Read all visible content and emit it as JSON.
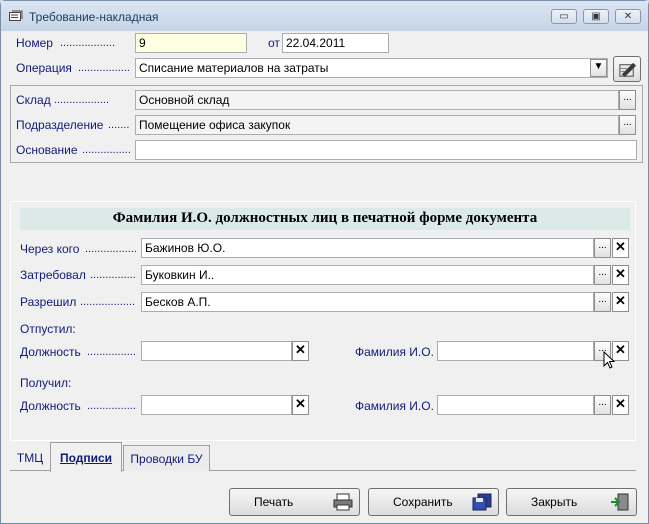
{
  "window": {
    "title": "Требование-накладная",
    "min_btn": "▭",
    "max_btn": "▣",
    "close_btn": "✕"
  },
  "form": {
    "nomer_label": "Номер",
    "nomer_value": "9",
    "ot_label": "от",
    "date_value": "22.04.2011",
    "operation_label": "Операция",
    "operation_value": "Списание материалов на затраты",
    "sklad_label": "Склад",
    "sklad_value": "Основной склад",
    "podr_label": "Подразделение",
    "podr_value": "Помещение офиса закупок",
    "osnovanie_label": "Основание",
    "osnovanie_value": ""
  },
  "signatures": {
    "header": "Фамилия И.О. должностных лиц в печатной форме документа",
    "cherez_label": "Через кого",
    "cherez_value": "Бажинов Ю.О.",
    "zatreboval_label": "Затребовал",
    "zatreboval_value": "Буковкин И..",
    "razreshil_label": "Разрешил",
    "razreshil_value": "Бесков А.П.",
    "otpustil_label": "Отпустил:",
    "poluchil_label": "Получил:",
    "dolzhnost_label": "Должность",
    "fio_label": "Фамилия И.О.",
    "otpustil_dolzhnost": "",
    "otpustil_fio": "",
    "poluchil_dolzhnost": "",
    "poluchil_fio": ""
  },
  "tabs": [
    "ТМЦ",
    "Подписи",
    "Проводки БУ"
  ],
  "active_tab": "Подписи",
  "buttons": {
    "print": "Печать",
    "save": "Сохранить",
    "close": "Закрыть"
  },
  "ellipsis": "...",
  "clear": "✕",
  "dropdown": "▼",
  "dots_short": "..................",
  "dots_long": "...................................",
  "colors": {
    "label": "#101a7a",
    "header_bg": "#dbe9e9",
    "yellow_field": "#ffffe1"
  }
}
